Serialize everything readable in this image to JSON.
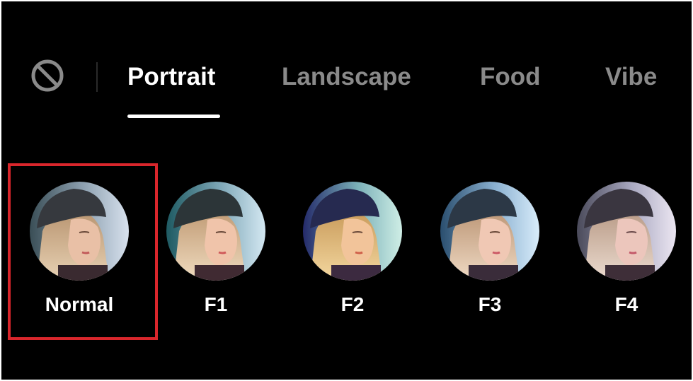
{
  "colors": {
    "background": "#000000",
    "active_tab": "#ffffff",
    "inactive_tab": "#8a8a8a",
    "selection_outline": "#d9262c"
  },
  "no_filter": {
    "icon": "no-filter-icon"
  },
  "tabs": [
    {
      "label": "Portrait",
      "active": true
    },
    {
      "label": "Landscape",
      "active": false
    },
    {
      "label": "Food",
      "active": false
    },
    {
      "label": "Vibe",
      "active": false
    }
  ],
  "filters": [
    {
      "label": "Normal",
      "selected": true
    },
    {
      "label": "F1",
      "selected": false
    },
    {
      "label": "F2",
      "selected": false
    },
    {
      "label": "F3",
      "selected": false
    },
    {
      "label": "F4",
      "selected": false
    }
  ]
}
